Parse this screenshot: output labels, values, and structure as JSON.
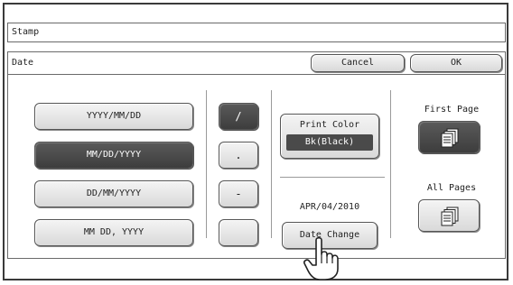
{
  "header": {
    "title": "Stamp"
  },
  "subheader": {
    "title": "Date",
    "cancel_label": "Cancel",
    "ok_label": "OK"
  },
  "formats": [
    "YYYY/MM/DD",
    "MM/DD/YYYY",
    "DD/MM/YYYY",
    "MM DD, YYYY"
  ],
  "selected_format": "MM/DD/YYYY",
  "separators": [
    "/",
    ".",
    "-",
    ""
  ],
  "selected_separator": "/",
  "print_color": {
    "label": "Print Color",
    "value": "Bk(Black)"
  },
  "date": {
    "value": "APR/04/2010",
    "change_label": "Date Change"
  },
  "pages": {
    "first_label": "First Page",
    "all_label": "All Pages",
    "selected": "First Page"
  },
  "icons": {
    "first_page": "pages-stack-icon",
    "all_pages": "pages-stack-icon",
    "pointer": "hand-pointer-icon"
  }
}
